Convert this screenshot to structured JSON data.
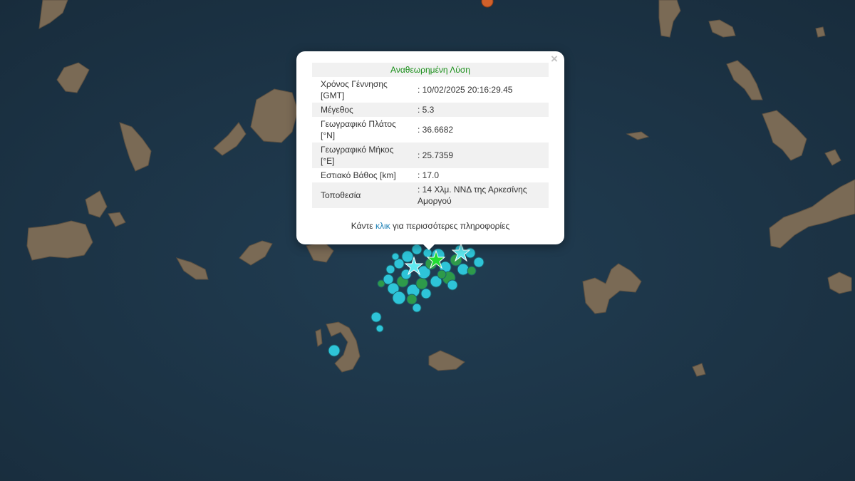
{
  "map": {
    "sea_color": "#1d3547",
    "land_color": "#7a6a55",
    "event_colors": {
      "recent": "#2ec4d8",
      "older": "#2e9a4a",
      "highlight": "#22dd33",
      "offmap": "#d0602a"
    },
    "star_icon": "star-marker-icon"
  },
  "popup": {
    "title": "Αναθεωρημένη Λύση",
    "close_label": "×",
    "rows": [
      {
        "label": "Χρόνος Γέννησης [GMT]",
        "value": ": 10/02/2025 20:16:29.45"
      },
      {
        "label": "Μέγεθος",
        "value": ": 5.3"
      },
      {
        "label": "Γεωγραφικό Πλάτος [°N]",
        "value": ": 36.6682"
      },
      {
        "label": "Γεωγραφικό Μήκος [°E]",
        "value": ": 25.7359"
      },
      {
        "label": "Εστιακό Βάθος [km]",
        "value": ": 17.0"
      },
      {
        "label": "Τοποθεσία",
        "value": ": 14 Χλμ. ΝΝΔ της Αρκεσίνης Αμοργού"
      }
    ],
    "more_prefix": "Κάντε",
    "more_link": "κλικ",
    "more_suffix": "για περισσότερες πληροφορίες"
  }
}
